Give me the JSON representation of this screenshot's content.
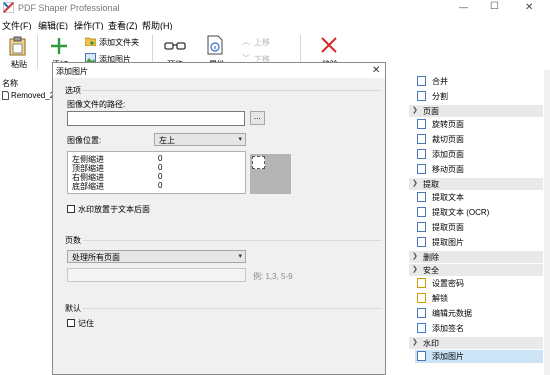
{
  "window": {
    "title": "PDF Shaper Professional",
    "minimize": "—",
    "restore": "☐",
    "close": "✕"
  },
  "menu": [
    "文件(F)",
    "编辑(E)",
    "操作(T)",
    "查看(Z)",
    "帮助(H)"
  ],
  "toolbar": {
    "paste": "粘贴",
    "add": "添加",
    "add_folder": "添加文件夹",
    "add_image": "添加图片",
    "preview": "预览",
    "info": "属性",
    "move_up": "上移",
    "move_down": "下移",
    "remove": "移除"
  },
  "file_list": {
    "header": "名称",
    "items": [
      "Removed_2"
    ]
  },
  "right_panel": {
    "sections": [
      {
        "type": "item",
        "icon": "merge-icon",
        "label": "合并"
      },
      {
        "type": "item",
        "icon": "split-icon",
        "label": "分割"
      },
      {
        "type": "header",
        "label": "页面"
      },
      {
        "type": "item",
        "icon": "rotate-page-icon",
        "label": "旋转页面"
      },
      {
        "type": "item",
        "icon": "crop-page-icon",
        "label": "裁切页面"
      },
      {
        "type": "item",
        "icon": "add-page-icon",
        "label": "添加页面"
      },
      {
        "type": "item",
        "icon": "move-page-icon",
        "label": "移动页面"
      },
      {
        "type": "header",
        "label": "提取"
      },
      {
        "type": "item",
        "icon": "extract-text-icon",
        "label": "提取文本"
      },
      {
        "type": "item",
        "icon": "extract-ocr-icon",
        "label": "提取文本 (OCR)"
      },
      {
        "type": "item",
        "icon": "extract-page-icon",
        "label": "提取页面"
      },
      {
        "type": "item",
        "icon": "extract-image-icon",
        "label": "提取图片"
      },
      {
        "type": "header",
        "label": "删除"
      },
      {
        "type": "header",
        "label": "安全"
      },
      {
        "type": "item",
        "icon": "set-password-icon",
        "label": "设置密码"
      },
      {
        "type": "item",
        "icon": "decrypt-icon",
        "label": "解锁"
      },
      {
        "type": "item",
        "icon": "edit-metadata-icon",
        "label": "编辑元数据"
      },
      {
        "type": "item",
        "icon": "add-signature-icon",
        "label": "添加签名"
      },
      {
        "type": "header",
        "label": "水印"
      },
      {
        "type": "item",
        "icon": "add-image-icon",
        "label": "添加图片",
        "selected": true
      }
    ]
  },
  "dialog": {
    "title": "添加图片",
    "close": "✕",
    "options_group": "选项",
    "image_path_label": "图像文件的路径:",
    "image_path_value": "",
    "browse": "...",
    "position_label": "图像位置:",
    "position_value": "左上",
    "margins": [
      {
        "label": "左侧缩进",
        "value": "0"
      },
      {
        "label": "顶部缩进",
        "value": "0"
      },
      {
        "label": "右侧缩进",
        "value": "0"
      },
      {
        "label": "底部缩进",
        "value": "0"
      }
    ],
    "behind_text": "水印放置于文本后面",
    "pages_group": "页数",
    "pages_value": "处理所有页面",
    "pages_hint": "例: 1,3, 5-9",
    "default_group": "默认",
    "remember": "记住"
  },
  "colors": {
    "accent": "#2f6bd0",
    "add_icon": "#2c9a3a",
    "remove_icon": "#d62a2a",
    "selected_bg": "#cde4f7"
  }
}
